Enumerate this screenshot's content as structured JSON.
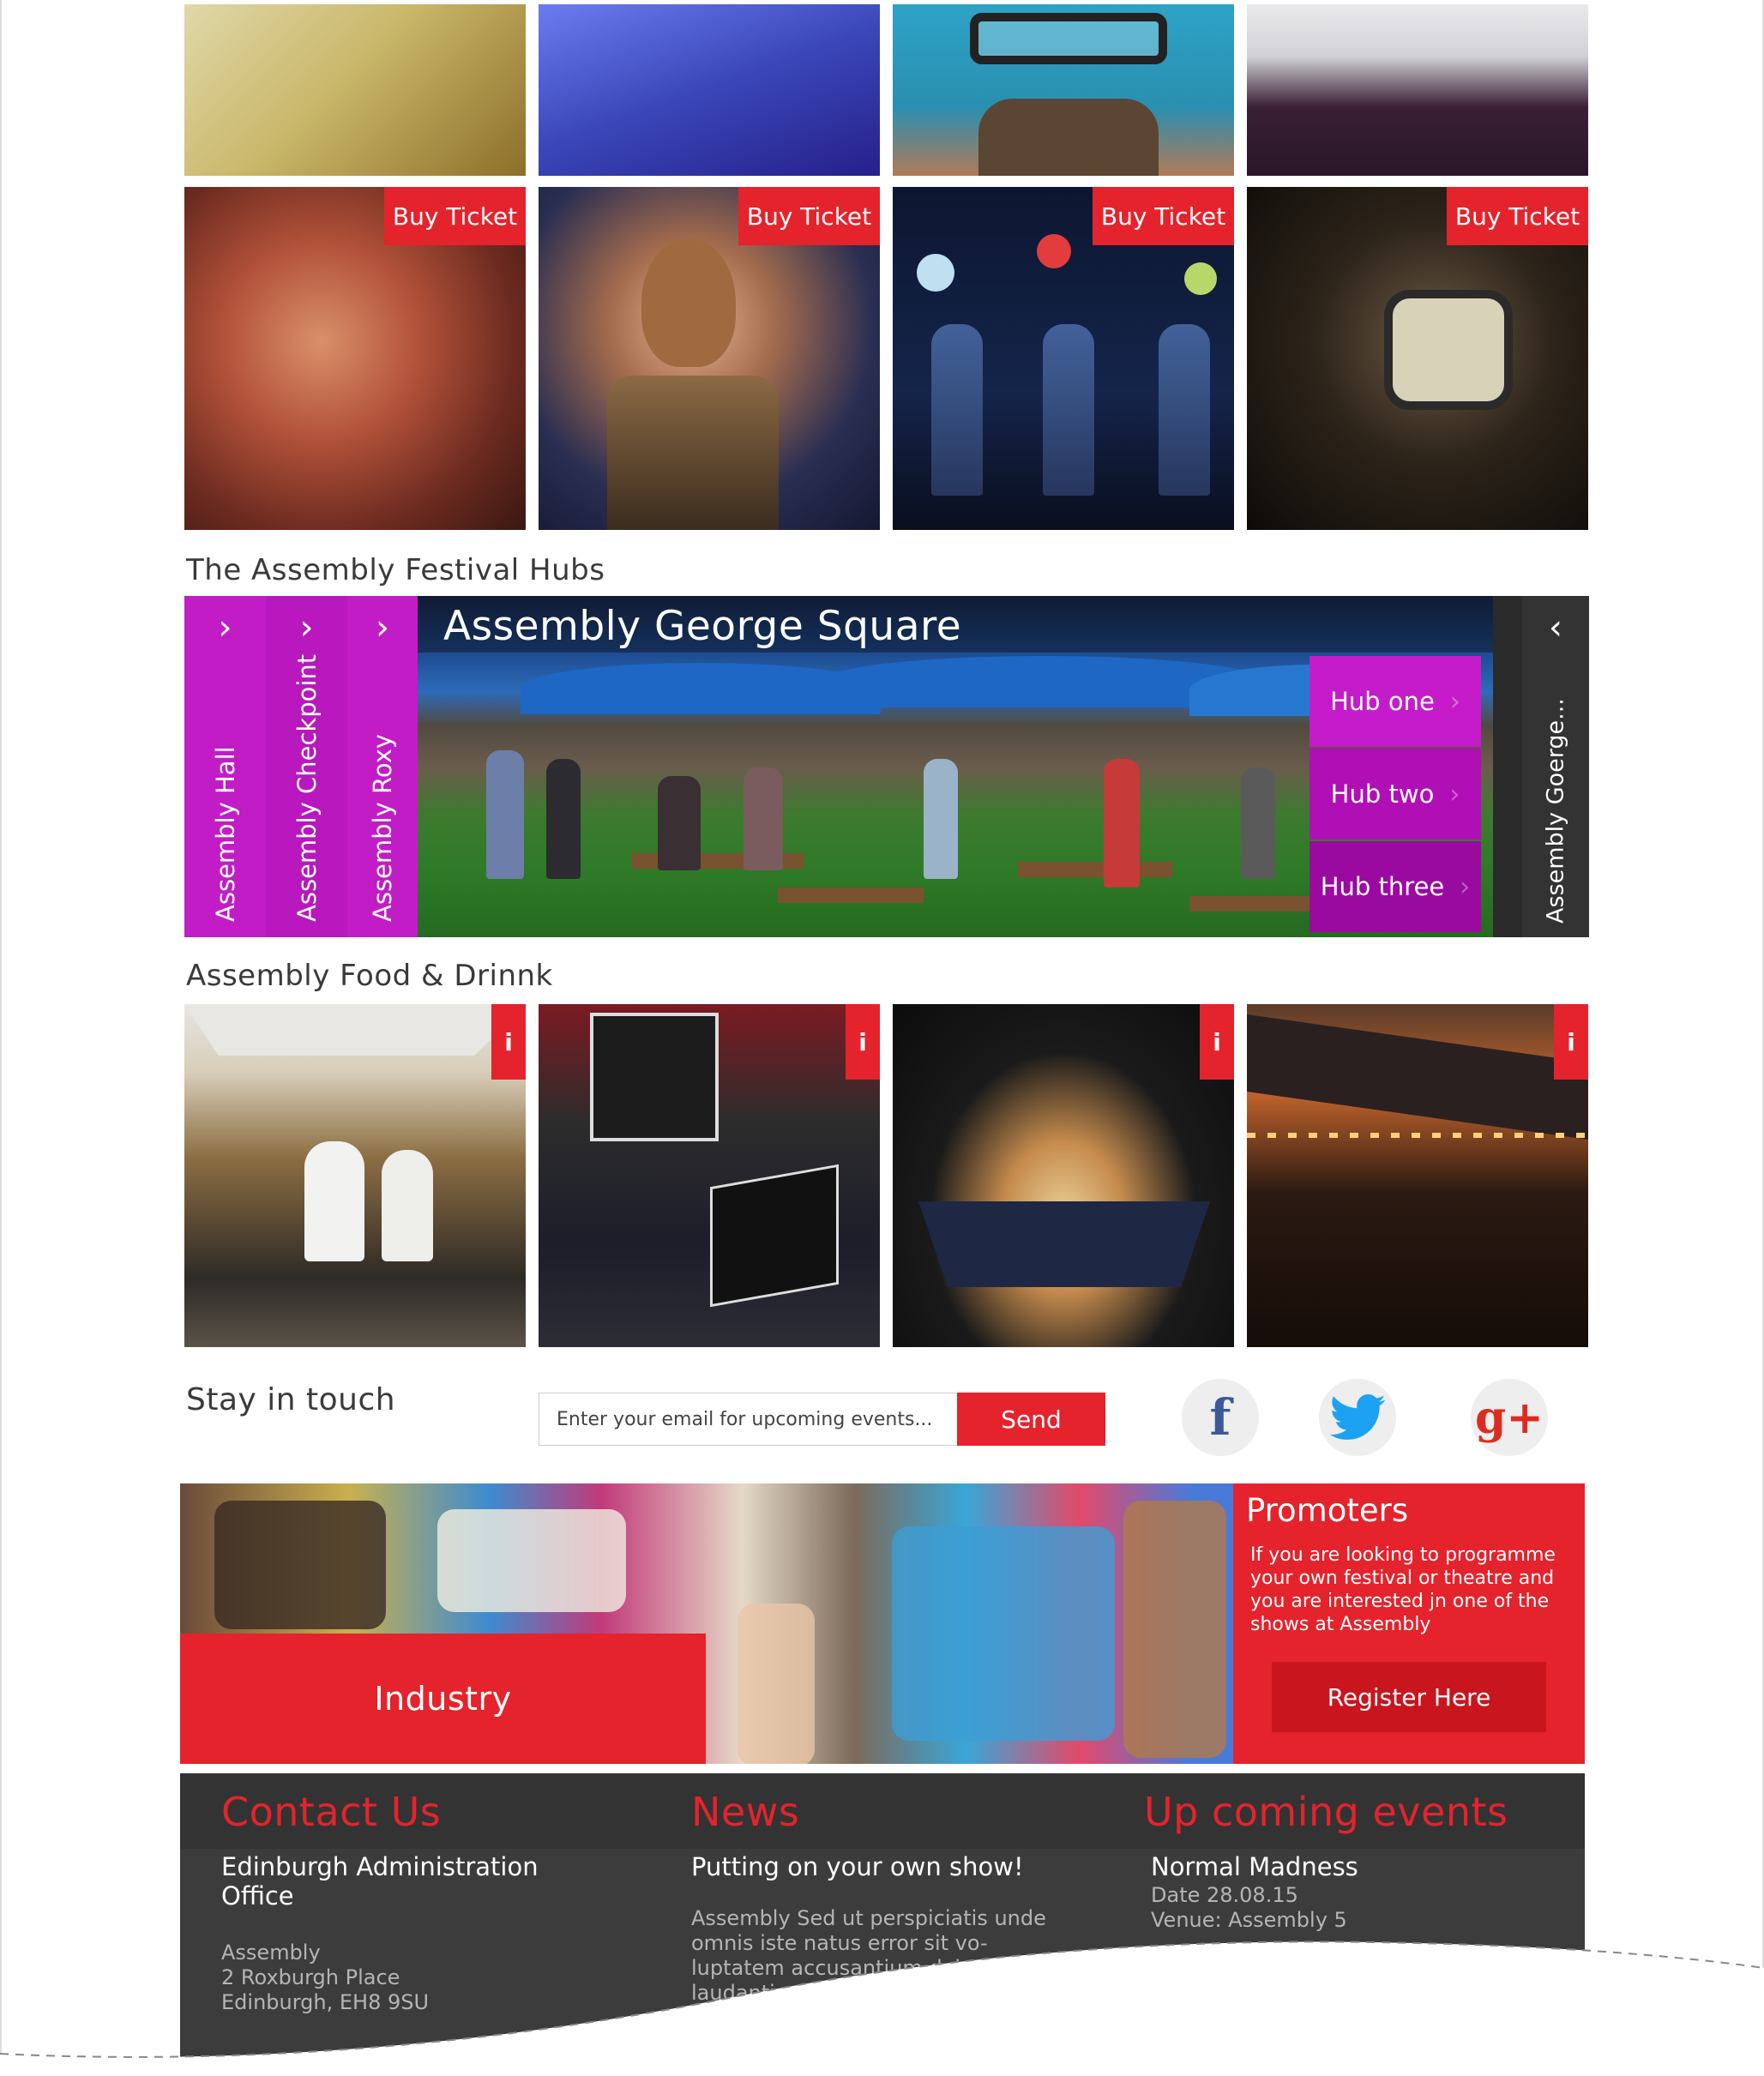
{
  "shows": {
    "buy_label": "Buy Ticket"
  },
  "hubs": {
    "section_title": "The Assembly Festival Hubs",
    "tabs": [
      {
        "label": "Assembly Hall"
      },
      {
        "label": "Assembly Checkpoint"
      },
      {
        "label": "Assembly Roxy"
      }
    ],
    "active_title": "Assembly George Square",
    "menu": [
      {
        "label": "Hub one",
        "color": "#c61bcb"
      },
      {
        "label": "Hub two",
        "color": "#b10fb6"
      },
      {
        "label": "Hub three",
        "color": "#9b0aa0"
      }
    ],
    "side_label": "Assembly Goerge...",
    "tab_color": "#c21cc7"
  },
  "food": {
    "section_title": "Assembly Food & Drinnk",
    "info_label": "i"
  },
  "newsletter": {
    "title": "Stay in touch",
    "placeholder": "Enter your email for upcoming events...",
    "send_label": "Send"
  },
  "social": [
    {
      "icon": "facebook-icon",
      "glyph": "f",
      "color": "#3b5998"
    },
    {
      "icon": "twitter-icon",
      "glyph": "🐦",
      "color": "#1da1f2"
    },
    {
      "icon": "google-plus-icon",
      "glyph": "g+",
      "color": "#dd2c1f"
    }
  ],
  "promo": {
    "industry_label": "Industry",
    "promoters_title": "Promoters",
    "promoters_text": "If you are looking to programme your own festival or theatre and you are interested jn one of the shows at Assembly",
    "register_label": "Register Here"
  },
  "footer": {
    "contact": {
      "heading": "Contact Us",
      "office": "Edinburgh Administration Office",
      "address_line1": "Assembly",
      "address_line2": "2 Roxburgh Place",
      "address_line3": "Edinburgh, EH8 9SU"
    },
    "news": {
      "heading": "News",
      "headline": "Putting on your own show!",
      "body": "Assembly Sed ut perspiciatis unde omnis iste natus error sit vo- luptatem accusantium doloremque laudantium, totam rem aperiam, eaque ipsa quae"
    },
    "events": {
      "heading": "Up coming events",
      "title": "Normal Madness",
      "date": "Date 28.08.15",
      "venue": "Venue: Assembly 5"
    }
  },
  "colors": {
    "accent": "#e4232c",
    "magenta": "#c21cc7",
    "footer": "#3c3c3c"
  }
}
